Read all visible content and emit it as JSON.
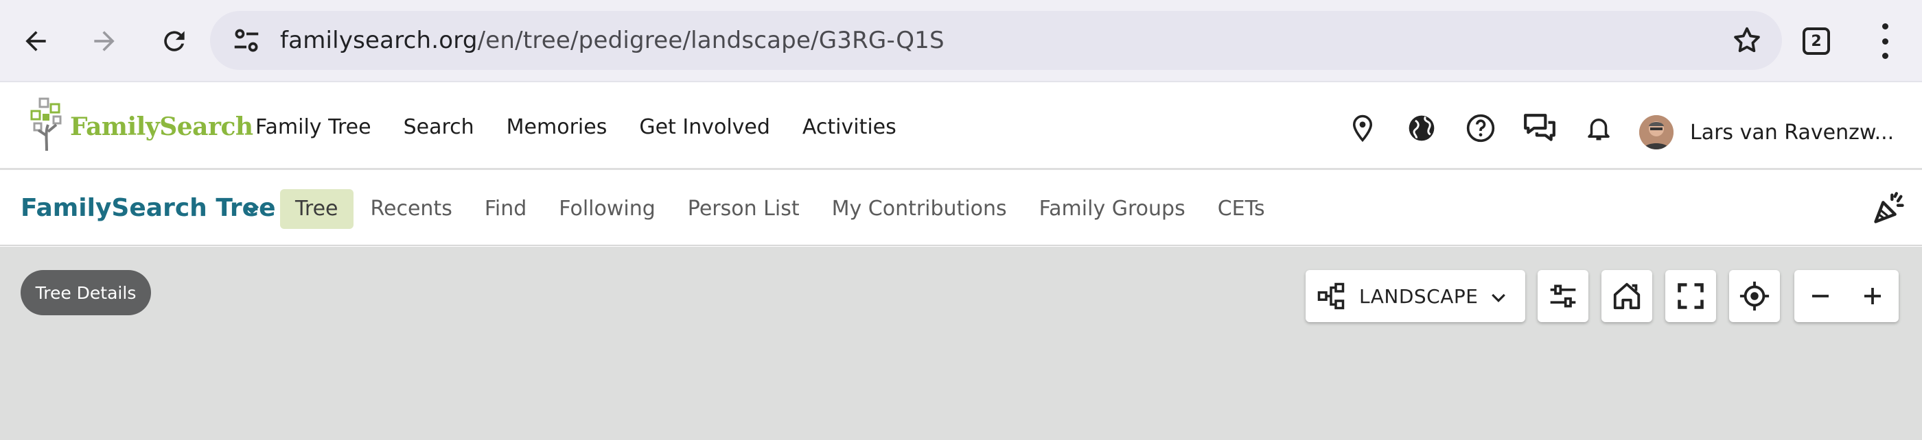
{
  "browser": {
    "url_host": "familysearch.org",
    "url_path": "/en/tree/pedigree/landscape/G3RG-Q1S",
    "tab_count": "2"
  },
  "header": {
    "logo_text": "FamilySearch",
    "nav": [
      "Family Tree",
      "Search",
      "Memories",
      "Get Involved",
      "Activities"
    ],
    "user_name": "Lars van Ravenzw..."
  },
  "subnav": {
    "title": "FamilySearch Tree",
    "tabs": [
      "Tree",
      "Recents",
      "Find",
      "Following",
      "Person List",
      "My Contributions",
      "Family Groups",
      "CETs"
    ],
    "active_tab": "Tree"
  },
  "canvas": {
    "tree_details_label": "Tree Details",
    "view_mode": "LANDSCAPE"
  },
  "colors": {
    "brand_green": "#8cb83e",
    "title_teal": "#1c6e84",
    "active_tab_bg": "#dfe8c3",
    "canvas_bg": "#dddedd"
  }
}
